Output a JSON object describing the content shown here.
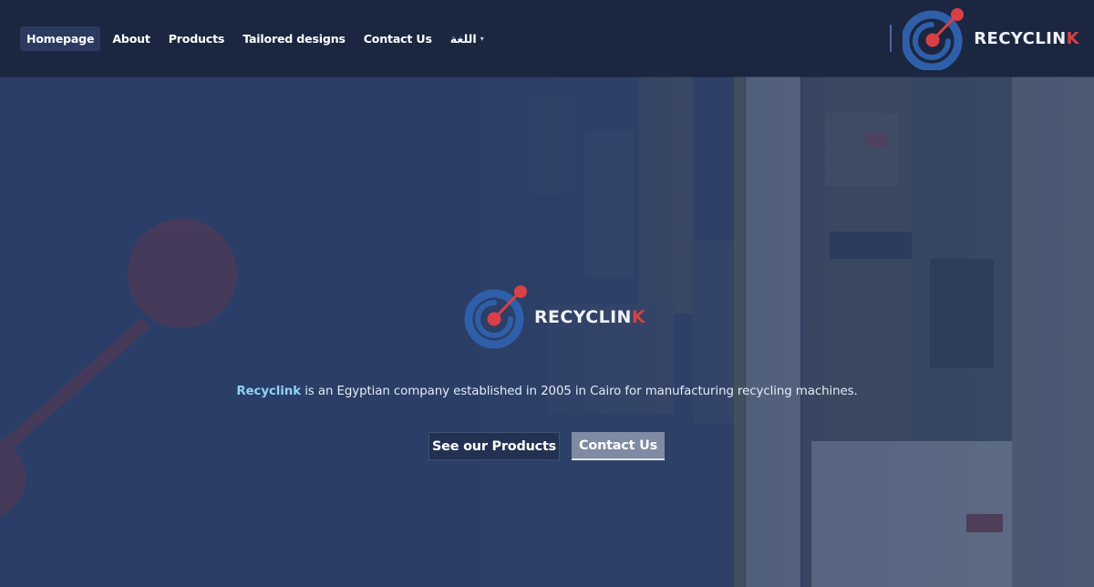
{
  "nav": {
    "items": [
      {
        "label": "Homepage",
        "active": true
      },
      {
        "label": "About"
      },
      {
        "label": "Products"
      },
      {
        "label": "Tailored designs"
      },
      {
        "label": "Contact Us"
      }
    ],
    "language_label": "اللغة"
  },
  "brand": {
    "name_main": "RECYCLIN",
    "name_accent": "K",
    "accent_color": "#d94045",
    "logo_blue": "#2f5fa8"
  },
  "hero": {
    "brand_word": "Recyclink",
    "tagline_rest": " is an Egyptian company established in 2005 in Cairo for manufacturing recycling machines.",
    "primary_button": "See our Products",
    "secondary_button": "Contact Us"
  },
  "icons": {
    "logo": "recyclink-logo-icon",
    "language_chevron": "chevron-down-icon"
  }
}
